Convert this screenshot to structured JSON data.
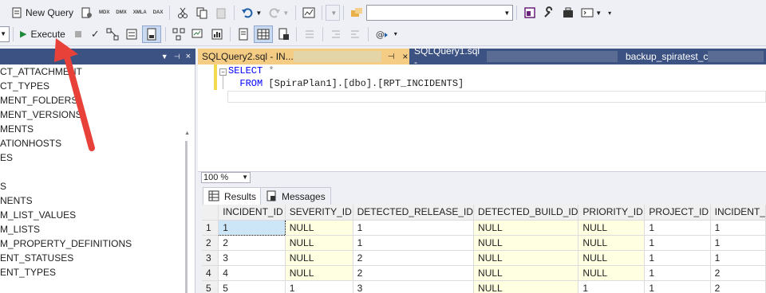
{
  "toolbar": {
    "new_query_label": "New Query",
    "execute_label": "Execute",
    "query_type_icons": [
      "MDX",
      "DMX",
      "XMLA",
      "DAX"
    ]
  },
  "explorer": {
    "items": [
      "CT_ATTACHMENT",
      "CT_TYPES",
      "MENT_FOLDERS",
      "MENT_VERSIONS",
      "MENTS",
      "ATIONHOSTS",
      "ES",
      "",
      "S",
      "NENTS",
      "M_LIST_VALUES",
      "M_LISTS",
      "M_PROPERTY_DEFINITIONS",
      "ENT_STATUSES",
      "ENT_TYPES"
    ]
  },
  "tabs": [
    {
      "label": "SQLQuery2.sql - IN...",
      "pin": "⊣",
      "close": "×"
    },
    {
      "label": "SQLQuery1.sql -"
    },
    {
      "label": "backup_spiratest_c"
    }
  ],
  "editor": {
    "line1_keyword": "SELECT",
    "line1_rest": " *",
    "line2_keyword": "FROM",
    "line2_rest": " [SpiraPlan1].[dbo].[RPT_INCIDENTS]",
    "outline_toggle": "−"
  },
  "zoom": "100 %",
  "results_tabs": {
    "results_label": "Results",
    "messages_label": "Messages"
  },
  "grid": {
    "columns": [
      "INCIDENT_ID",
      "SEVERITY_ID",
      "DETECTED_RELEASE_ID",
      "DETECTED_BUILD_ID",
      "PRIORITY_ID",
      "PROJECT_ID",
      "INCIDENT_"
    ],
    "rows": [
      [
        "1",
        "1",
        "NULL",
        "1",
        "NULL",
        "NULL",
        "1",
        "1"
      ],
      [
        "2",
        "2",
        "NULL",
        "1",
        "NULL",
        "NULL",
        "1",
        "1"
      ],
      [
        "3",
        "3",
        "NULL",
        "2",
        "NULL",
        "NULL",
        "1",
        "1"
      ],
      [
        "4",
        "4",
        "NULL",
        "2",
        "NULL",
        "NULL",
        "1",
        "2"
      ],
      [
        "5",
        "5",
        "1",
        "3",
        "NULL",
        "1",
        "1",
        "2"
      ]
    ]
  },
  "colors": {
    "accent_tab": "#f5cc84",
    "title_bar": "#3c5283",
    "null_cell": "#ffffe1",
    "arrow": "#e8413a"
  }
}
